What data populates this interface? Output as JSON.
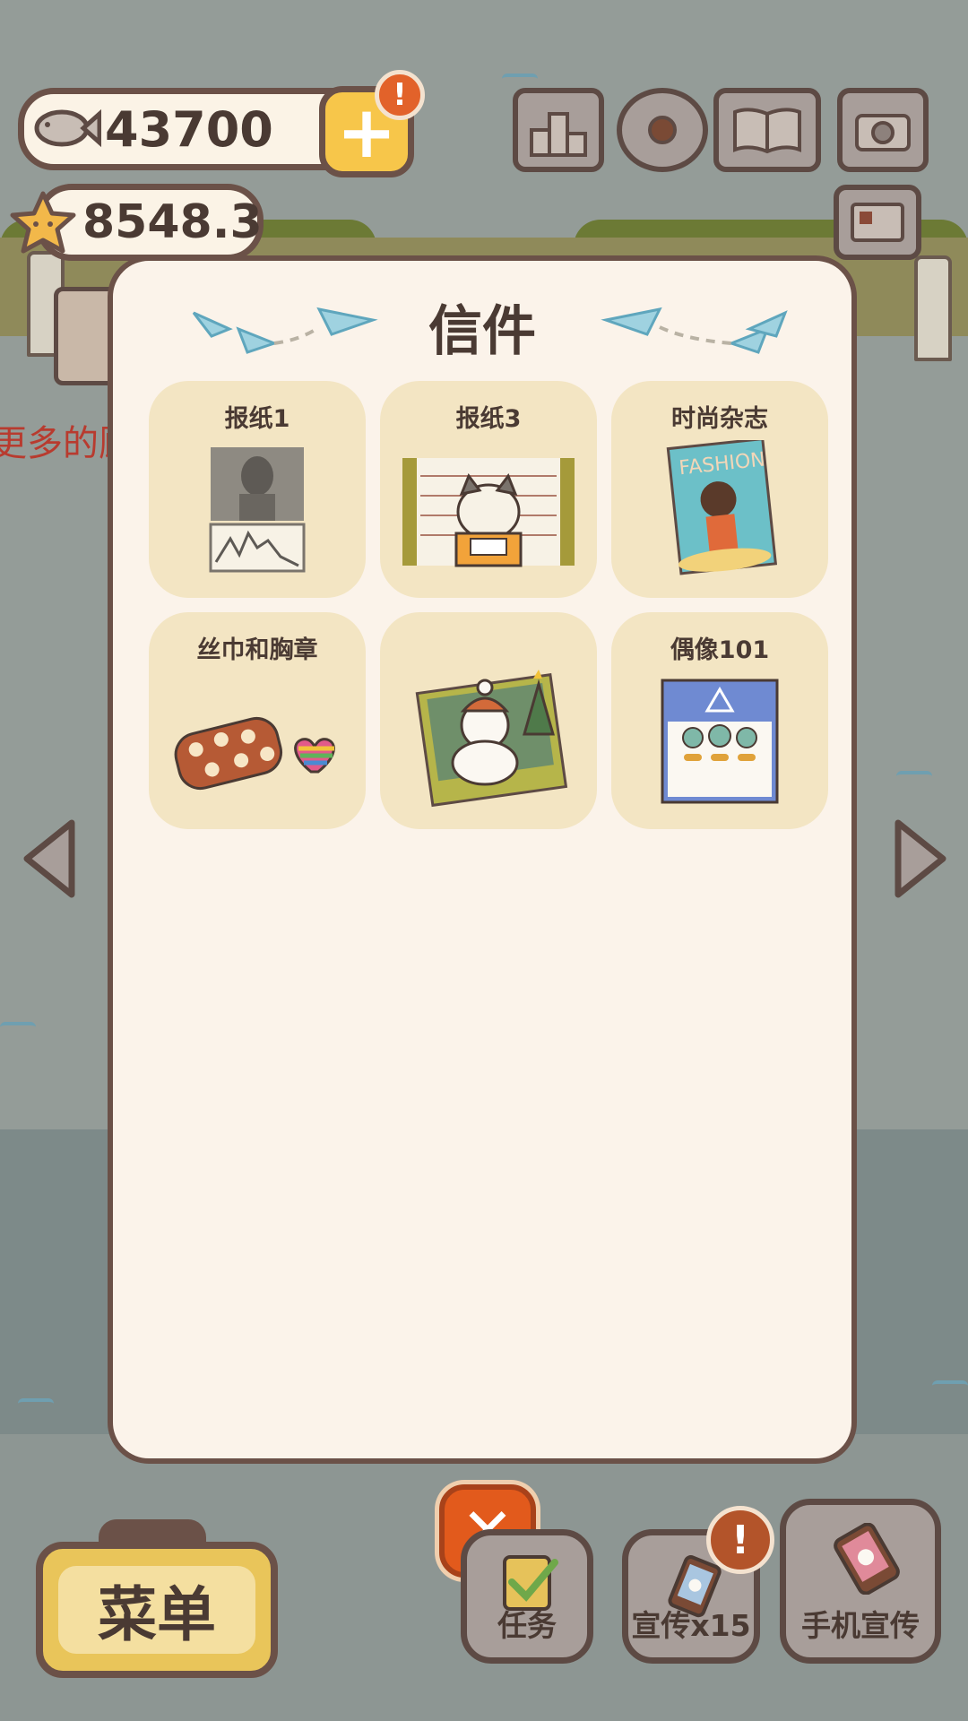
{
  "hud": {
    "fish_count": "43700",
    "star_count": "8548.3",
    "add_badge": "!"
  },
  "background": {
    "side_text": "更多的顾"
  },
  "modal": {
    "title": "信件",
    "cards": [
      {
        "label": "报纸1",
        "icon": "newspaper-photo"
      },
      {
        "label": "报纸3",
        "icon": "cat-mugshot"
      },
      {
        "label": "时尚杂志",
        "icon": "fashion-magazine"
      },
      {
        "label": "丝巾和胸章",
        "icon": "scarf-and-heart-pin"
      },
      {
        "label": "",
        "icon": "snowman-christmas-card"
      },
      {
        "label": "偶像101",
        "icon": "idol-poster"
      }
    ]
  },
  "bottom_bar": {
    "menu_label": "菜单",
    "task_label": "任务",
    "promo_label": "宣传x15",
    "promo_badge": "!",
    "phone_promo_label": "手机宣传"
  },
  "colors": {
    "accent_orange": "#e25a1c",
    "card_bg": "#f3e5c3",
    "modal_bg": "#fbf3ea",
    "border_brown": "#6b5148"
  }
}
